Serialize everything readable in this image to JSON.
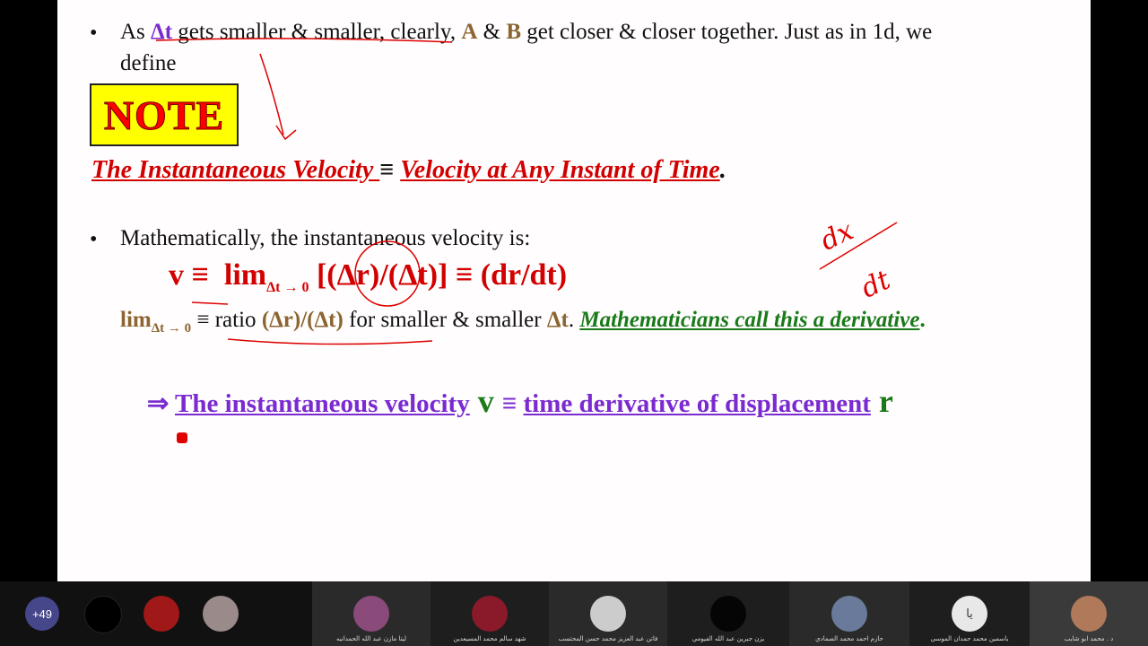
{
  "slide": {
    "bullet_char": "•",
    "line1": {
      "p1": "As ",
      "dt": "Δt",
      "p2": " gets smaller & smaller, clearly, ",
      "a": "A",
      "amp": " & ",
      "b": "B",
      "p3": " get closer & closer together. Just as in 1d, we"
    },
    "line1b": "define",
    "note_label": "NOTE",
    "definition": {
      "left": "The Instantaneous Velocity ",
      "equiv": "≡ ",
      "right": "Velocity at Any Instant of Time",
      "period": "."
    },
    "bullet2": "Mathematically, the instantaneous velocity is:",
    "formula": {
      "v": "v ≡",
      "lim": "lim",
      "sub": "Δt → 0",
      "rest": " [(Δr)/(Δt)] ≡ (dr/dt)"
    },
    "limit_line": {
      "lim": "lim",
      "sub": "Δt → 0",
      "equiv": " ≡ ",
      "ratio": " ratio ",
      "ratio_expr": "(Δr)/(Δt)",
      "mid": " for smaller & smaller ",
      "dt": "Δt",
      "dot": ". ",
      "math": "Mathematicians call this a derivative",
      "end": "."
    },
    "conclusion": {
      "arrow": "⇒ ",
      "p1": "The instantaneous velocity",
      "v": " v ",
      "equiv": "≡ ",
      "p2": "time derivative of displacement",
      "r": " r"
    },
    "handwriting": {
      "dx": "dx",
      "dt": "dt"
    }
  },
  "participants": {
    "more_count": "+49",
    "tiles": [
      {
        "name": "ليتا مازن عبد الله الحمدانيه",
        "avatar_color": "#8a4a7a"
      },
      {
        "name": "شهد سالم محمد المسيعدين",
        "avatar_color": "#8a1a2a"
      },
      {
        "name": "فاتن عبد العزيز محمد حسن المحتسب",
        "avatar_color": "#cccccc"
      },
      {
        "name": "يزن جبرين عبد الله الفيومي",
        "avatar_color": "#050505"
      },
      {
        "name": "حازم احمد محمد الصمادي",
        "avatar_color": "#6a7a9a"
      },
      {
        "name": "ياسمين محمد حمدان الموسى",
        "avatar_color": "#e8e8e8",
        "initial": "يا"
      },
      {
        "name": "د . محمد ابو شايب",
        "avatar_color": "#b07a5a"
      }
    ]
  },
  "colors": {
    "red": "#d20000",
    "brown": "#8b6430",
    "purple": "#7a2ad0",
    "green": "#1a7a1a",
    "note_bg": "#ffff00"
  }
}
